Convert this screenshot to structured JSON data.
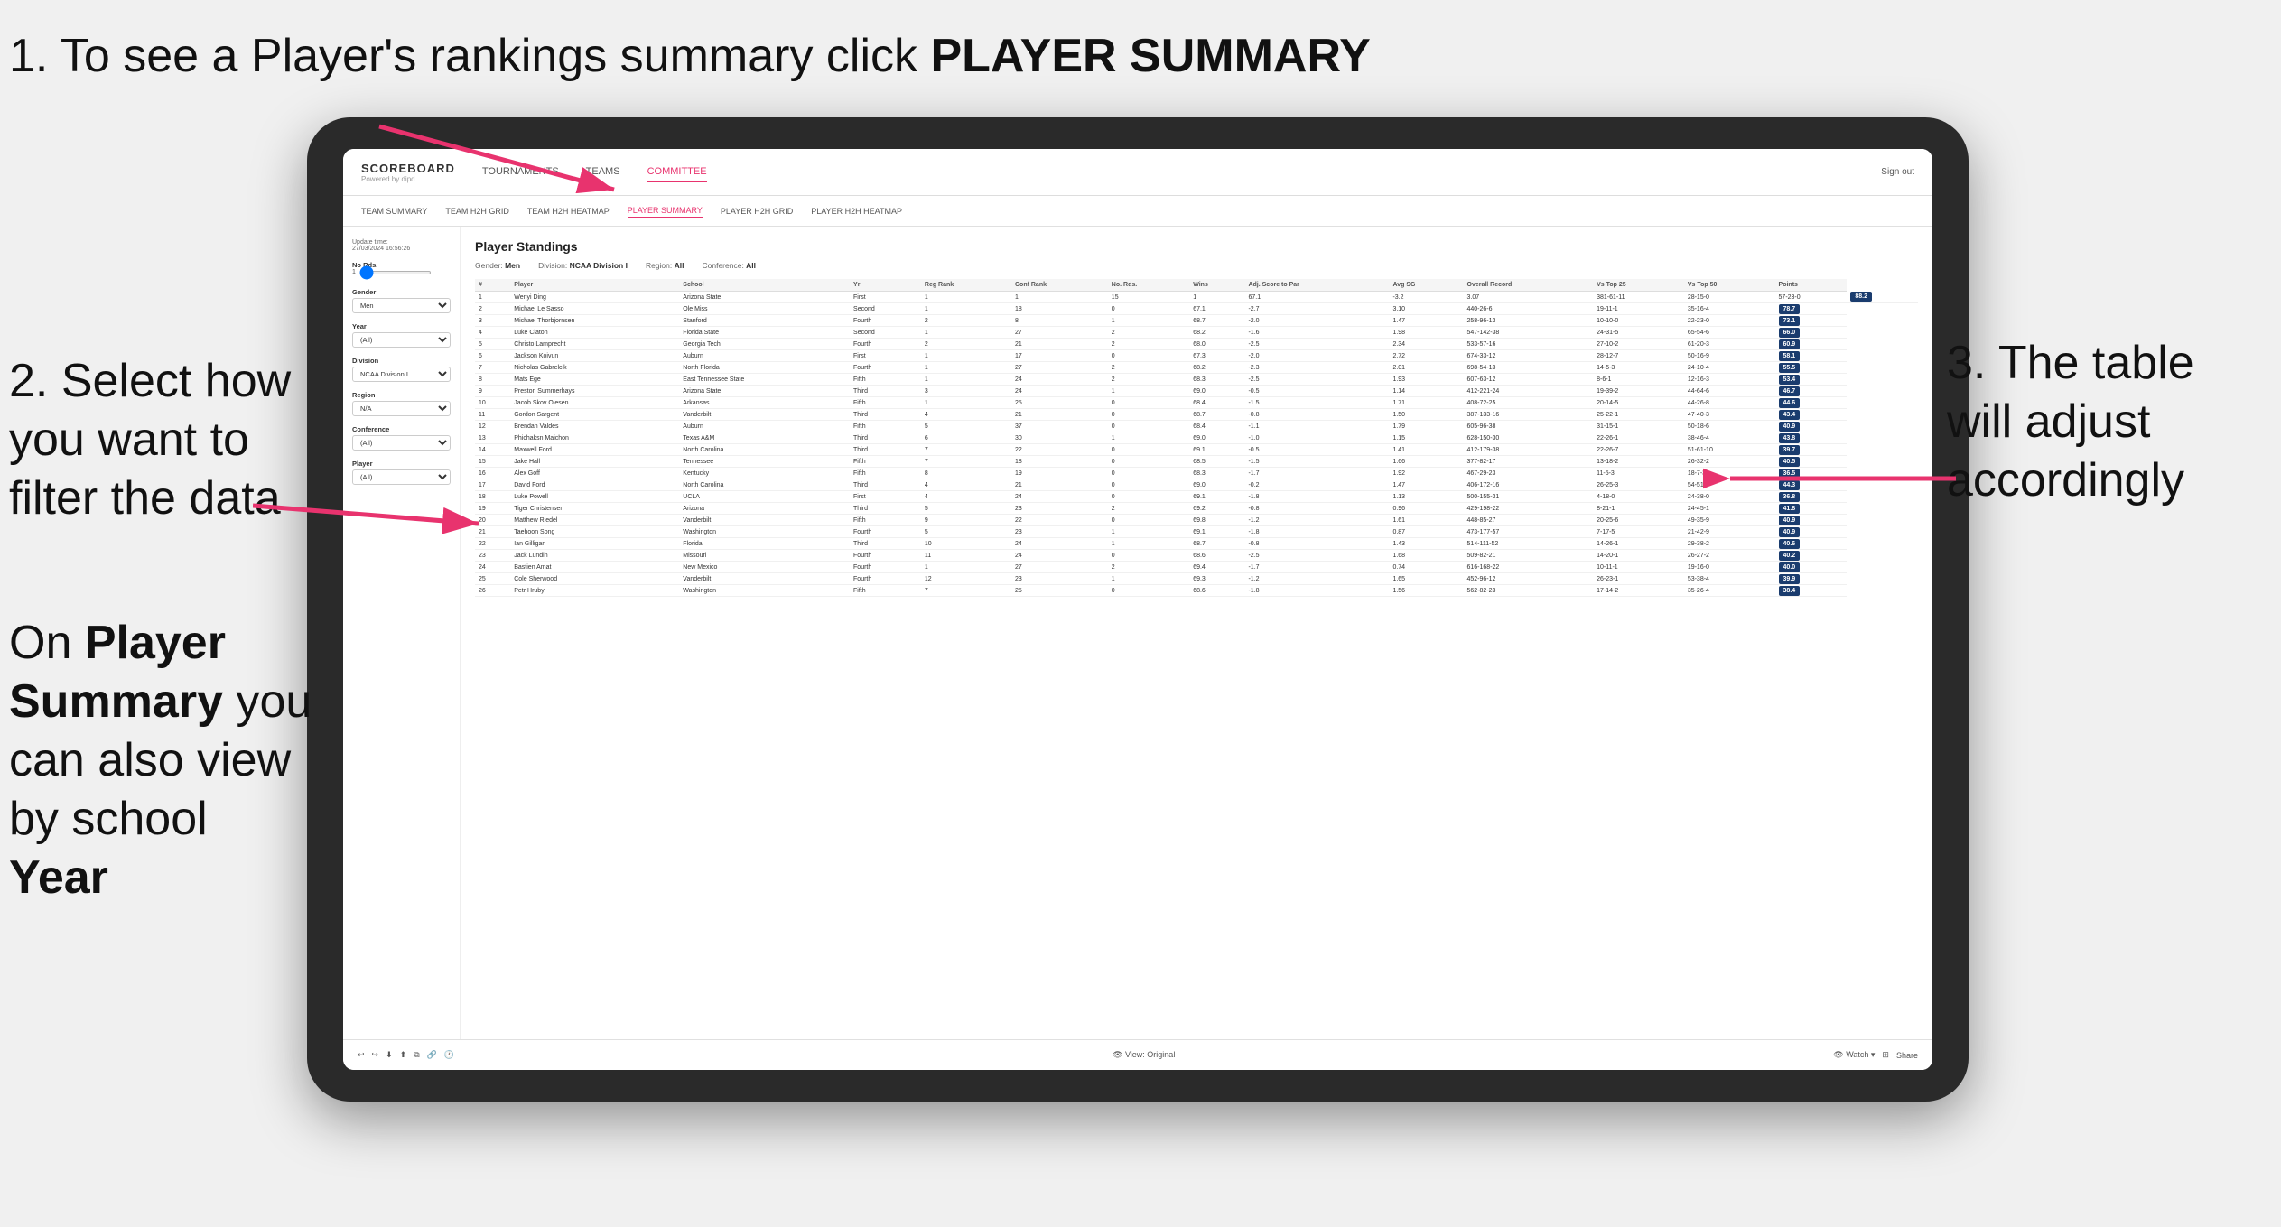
{
  "annotations": {
    "top_left": {
      "number": "1.",
      "text_normal": "To see a Player's rankings summary click ",
      "text_bold": "PLAYER SUMMARY"
    },
    "mid_left": {
      "text_normal": "2. Select how you want to ",
      "text_bold_1": "filter",
      "text_normal_2": " the data"
    },
    "bottom_left_line1": "On ",
    "bottom_left_bold1": "Player",
    "bottom_left_line2": "Summary",
    "bottom_left_normal2": " you can also view by school ",
    "bottom_left_bold2": "Year",
    "right_annotation": "3. The table will adjust accordingly"
  },
  "nav": {
    "logo": "SCOREBOARD",
    "logo_sub": "Powered by dipd",
    "links": [
      "TOURNAMENTS",
      "TEAMS",
      "COMMITTEE"
    ],
    "active_link": "COMMITTEE",
    "right": [
      "Sign out"
    ]
  },
  "sub_nav": {
    "links": [
      "TEAM SUMMARY",
      "TEAM H2H GRID",
      "TEAM H2H HEATMAP",
      "PLAYER SUMMARY",
      "PLAYER H2H GRID",
      "PLAYER H2H HEATMAP"
    ],
    "active": "PLAYER SUMMARY"
  },
  "sidebar": {
    "update_label": "Update time:",
    "update_time": "27/03/2024 16:56:26",
    "no_rds_label": "No Rds.",
    "gender_label": "Gender",
    "gender_value": "Men",
    "year_label": "Year",
    "year_value": "(All)",
    "division_label": "Division",
    "division_value": "NCAA Division I",
    "region_label": "Region",
    "region_value": "N/A",
    "conference_label": "Conference",
    "conference_value": "(All)",
    "player_label": "Player",
    "player_value": "(All)"
  },
  "table": {
    "title": "Player Standings",
    "filters": {
      "gender_label": "Gender:",
      "gender_value": "Men",
      "division_label": "Division:",
      "division_value": "NCAA Division I",
      "region_label": "Region:",
      "region_value": "All",
      "conference_label": "Conference:",
      "conference_value": "All"
    },
    "columns": [
      "#",
      "Player",
      "School",
      "Yr",
      "Reg Rank",
      "Conf Rank",
      "No. Rds.",
      "Wins",
      "Adj. Score to Par",
      "Avg SG",
      "Overall Record",
      "Vs Top 25",
      "Vs Top 50",
      "Points"
    ],
    "rows": [
      [
        "1",
        "Wenyi Ding",
        "Arizona State",
        "First",
        "1",
        "1",
        "15",
        "1",
        "67.1",
        "-3.2",
        "3.07",
        "381-61-11",
        "28-15-0",
        "57-23-0",
        "88.2"
      ],
      [
        "2",
        "Michael Le Sasso",
        "Ole Miss",
        "Second",
        "1",
        "18",
        "0",
        "67.1",
        "-2.7",
        "3.10",
        "440-26-6",
        "19-11-1",
        "35-16-4",
        "78.7"
      ],
      [
        "3",
        "Michael Thorbjornsen",
        "Stanford",
        "Fourth",
        "2",
        "8",
        "1",
        "68.7",
        "-2.0",
        "1.47",
        "258-96-13",
        "10-10-0",
        "22-23-0",
        "73.1"
      ],
      [
        "4",
        "Luke Claton",
        "Florida State",
        "Second",
        "1",
        "27",
        "2",
        "68.2",
        "-1.6",
        "1.98",
        "547-142-38",
        "24-31-5",
        "65-54-6",
        "66.0"
      ],
      [
        "5",
        "Christo Lamprecht",
        "Georgia Tech",
        "Fourth",
        "2",
        "21",
        "2",
        "68.0",
        "-2.5",
        "2.34",
        "533-57-16",
        "27-10-2",
        "61-20-3",
        "60.9"
      ],
      [
        "6",
        "Jackson Koivun",
        "Auburn",
        "First",
        "1",
        "17",
        "0",
        "67.3",
        "-2.0",
        "2.72",
        "674-33-12",
        "28-12-7",
        "50-16-9",
        "58.1"
      ],
      [
        "7",
        "Nicholas Gabrelcik",
        "North Florida",
        "Fourth",
        "1",
        "27",
        "2",
        "68.2",
        "-2.3",
        "2.01",
        "698-54-13",
        "14-5-3",
        "24-10-4",
        "55.5"
      ],
      [
        "8",
        "Mats Ege",
        "East Tennessee State",
        "Fifth",
        "1",
        "24",
        "2",
        "68.3",
        "-2.5",
        "1.93",
        "607-63-12",
        "8-6-1",
        "12-16-3",
        "53.4"
      ],
      [
        "9",
        "Preston Summerhays",
        "Arizona State",
        "Third",
        "3",
        "24",
        "1",
        "69.0",
        "-0.5",
        "1.14",
        "412-221-24",
        "19-39-2",
        "44-64-6",
        "46.7"
      ],
      [
        "10",
        "Jacob Skov Olesen",
        "Arkansas",
        "Fifth",
        "1",
        "25",
        "0",
        "68.4",
        "-1.5",
        "1.71",
        "408-72-25",
        "20-14-5",
        "44-26-8",
        "44.6"
      ],
      [
        "11",
        "Gordon Sargent",
        "Vanderbilt",
        "Third",
        "4",
        "21",
        "0",
        "68.7",
        "-0.8",
        "1.50",
        "387-133-16",
        "25-22-1",
        "47-40-3",
        "43.4"
      ],
      [
        "12",
        "Brendan Valdes",
        "Auburn",
        "Fifth",
        "5",
        "37",
        "0",
        "68.4",
        "-1.1",
        "1.79",
        "605-96-38",
        "31-15-1",
        "50-18-6",
        "40.9"
      ],
      [
        "13",
        "Phichaksn Maichon",
        "Texas A&M",
        "Third",
        "6",
        "30",
        "1",
        "69.0",
        "-1.0",
        "1.15",
        "628-150-30",
        "22-26-1",
        "38-46-4",
        "43.8"
      ],
      [
        "14",
        "Maxwell Ford",
        "North Carolina",
        "Third",
        "7",
        "22",
        "0",
        "69.1",
        "-0.5",
        "1.41",
        "412-179-38",
        "22-26-7",
        "51-61-10",
        "39.7"
      ],
      [
        "15",
        "Jake Hall",
        "Tennessee",
        "Fifth",
        "7",
        "18",
        "0",
        "68.5",
        "-1.5",
        "1.66",
        "377-82-17",
        "13-18-2",
        "26-32-2",
        "40.5"
      ],
      [
        "16",
        "Alex Goff",
        "Kentucky",
        "Fifth",
        "8",
        "19",
        "0",
        "68.3",
        "-1.7",
        "1.92",
        "467-29-23",
        "11-5-3",
        "18-7-3",
        "36.5"
      ],
      [
        "17",
        "David Ford",
        "North Carolina",
        "Third",
        "4",
        "21",
        "0",
        "69.0",
        "-0.2",
        "1.47",
        "406-172-16",
        "26-25-3",
        "54-51-4",
        "44.3"
      ],
      [
        "18",
        "Luke Powell",
        "UCLA",
        "First",
        "4",
        "24",
        "0",
        "69.1",
        "-1.8",
        "1.13",
        "500-155-31",
        "4-18-0",
        "24-38-0",
        "36.8"
      ],
      [
        "19",
        "Tiger Christensen",
        "Arizona",
        "Third",
        "5",
        "23",
        "2",
        "69.2",
        "-0.8",
        "0.96",
        "429-198-22",
        "8-21-1",
        "24-45-1",
        "41.8"
      ],
      [
        "20",
        "Matthew Riedel",
        "Vanderbilt",
        "Fifth",
        "9",
        "22",
        "0",
        "69.8",
        "-1.2",
        "1.61",
        "448-85-27",
        "20-25-6",
        "49-35-9",
        "40.9"
      ],
      [
        "21",
        "Taehoon Song",
        "Washington",
        "Fourth",
        "5",
        "23",
        "1",
        "69.1",
        "-1.8",
        "0.87",
        "473-177-57",
        "7-17-5",
        "21-42-9",
        "40.9"
      ],
      [
        "22",
        "Ian Gilligan",
        "Florida",
        "Third",
        "10",
        "24",
        "1",
        "68.7",
        "-0.8",
        "1.43",
        "514-111-52",
        "14-26-1",
        "29-38-2",
        "40.6"
      ],
      [
        "23",
        "Jack Lundin",
        "Missouri",
        "Fourth",
        "11",
        "24",
        "0",
        "68.6",
        "-2.5",
        "1.68",
        "509-82-21",
        "14-20-1",
        "26-27-2",
        "40.2"
      ],
      [
        "24",
        "Bastien Amat",
        "New Mexico",
        "Fourth",
        "1",
        "27",
        "2",
        "69.4",
        "-1.7",
        "0.74",
        "616-168-22",
        "10-11-1",
        "19-16-0",
        "40.0"
      ],
      [
        "25",
        "Cole Sherwood",
        "Vanderbilt",
        "Fourth",
        "12",
        "23",
        "1",
        "69.3",
        "-1.2",
        "1.65",
        "452-96-12",
        "26-23-1",
        "53-38-4",
        "39.9"
      ],
      [
        "26",
        "Petr Hruby",
        "Washington",
        "Fifth",
        "7",
        "25",
        "0",
        "68.6",
        "-1.8",
        "1.56",
        "562-82-23",
        "17-14-2",
        "35-26-4",
        "38.4"
      ]
    ]
  },
  "toolbar": {
    "left_buttons": [
      "←",
      "→",
      "↓",
      "↑"
    ],
    "center": "View: Original",
    "right_buttons": [
      "👁 Watch",
      "Share"
    ]
  }
}
